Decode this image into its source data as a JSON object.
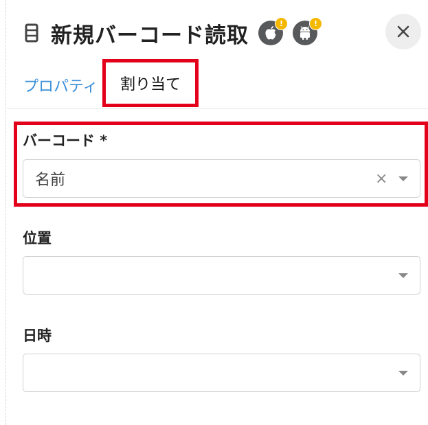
{
  "header": {
    "title": "新規バーコード読取",
    "icons": [
      "document-icon",
      "apple-icon",
      "android-icon",
      "close-icon"
    ],
    "warning_badge": "!",
    "badge_color": "#f5b800"
  },
  "tabs": [
    {
      "label": "プロパティ",
      "active": false
    },
    {
      "label": "割り当て",
      "active": true
    }
  ],
  "fields": {
    "barcode": {
      "label": "バーコード *",
      "value": "名前",
      "clear": "×"
    },
    "location": {
      "label": "位置",
      "value": ""
    },
    "datetime": {
      "label": "日時",
      "value": ""
    }
  },
  "colors": {
    "accent": "#3a8fd9",
    "highlight": "#e3001b",
    "platform_icon_bg": "#58595b"
  }
}
